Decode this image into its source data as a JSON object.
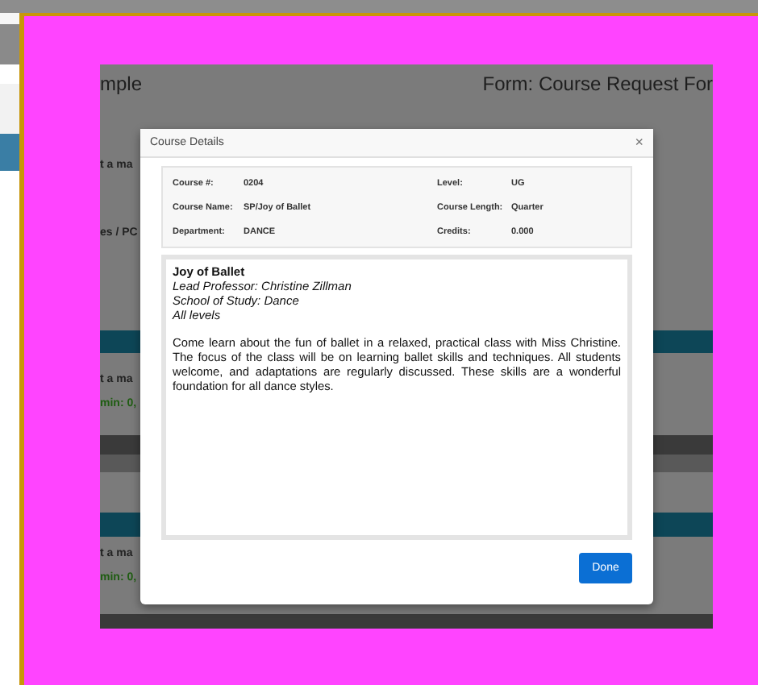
{
  "embedded_page": {
    "header": {
      "title_fragment": "mple",
      "form_title": "Form: Course Request For"
    },
    "rows": [
      {
        "kind": "text",
        "text": "t a ma"
      },
      {
        "kind": "text",
        "text": "es / PC"
      },
      {
        "kind": "teal_band"
      },
      {
        "kind": "text",
        "text": "t a ma"
      },
      {
        "kind": "green_text",
        "text": "min: 0,"
      },
      {
        "kind": "dark_band"
      },
      {
        "kind": "grey_band"
      },
      {
        "kind": "teal_band"
      },
      {
        "kind": "text",
        "text": "t a ma"
      },
      {
        "kind": "green_text",
        "text": "min: 0,"
      },
      {
        "kind": "dark_band"
      }
    ]
  },
  "modal": {
    "title": "Course Details",
    "close": "×",
    "details": [
      {
        "label": "Course #:",
        "value": "0204",
        "label_2": "Level:",
        "value_2": "UG"
      },
      {
        "label": "Course Name:",
        "value": "SP/Joy of Ballet",
        "label_2": "Course Length:",
        "value_2": "Quarter"
      },
      {
        "label": "Department:",
        "value": "DANCE",
        "label_2": "Credits:",
        "value_2": "0.000"
      }
    ],
    "description": {
      "heading": "Joy of Ballet",
      "lines": [
        "Lead Professor: Christine Zillman",
        "School of Study: Dance",
        "All levels"
      ],
      "body": "Come learn about the fun of ballet in a relaxed, practical class with Miss Christine. The focus of the class will be on learning ballet skills and techniques.  All students welcome, and adaptations are regularly discussed. These skills are a wonderful foundation for all dance styles."
    },
    "button": "Done"
  }
}
